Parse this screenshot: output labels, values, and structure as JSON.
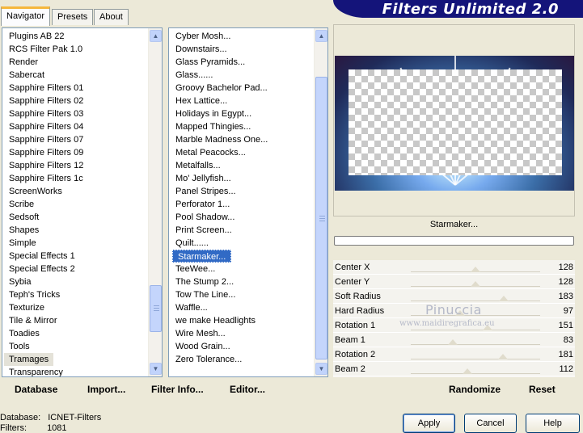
{
  "tabs": [
    "Navigator",
    "Presets",
    "About"
  ],
  "app_title": "Filters Unlimited 2.0",
  "categories": [
    "Plugins AB 22",
    "RCS Filter Pak 1.0",
    "Render",
    "Sabercat",
    "Sapphire Filters 01",
    "Sapphire Filters 02",
    "Sapphire Filters 03",
    "Sapphire Filters 04",
    "Sapphire Filters 07",
    "Sapphire Filters 09",
    "Sapphire Filters 12",
    "Sapphire Filters 1c",
    "ScreenWorks",
    "Scribe",
    "Sedsoft",
    "Shapes",
    "Simple",
    "Special Effects 1",
    "Special Effects 2",
    "Sybia",
    "Teph's Tricks",
    "Texturize",
    "Tile & Mirror",
    "Toadies",
    "Tools",
    "Tramages",
    "Transparency"
  ],
  "category_selected": "Tramages",
  "filters": [
    "Cyber Mosh...",
    "Downstairs...",
    "Glass Pyramids...",
    "Glass......",
    "Groovy Bachelor Pad...",
    "Hex Lattice...",
    "Holidays in Egypt...",
    "Mapped Thingies...",
    "Marble Madness One...",
    "Metal Peacocks...",
    "Metalfalls...",
    "Mo' Jellyfish...",
    "Panel Stripes...",
    "Perforator 1...",
    "Pool Shadow...",
    "Print Screen...",
    "Quilt......",
    "Starmaker...",
    "TeeWee...",
    "The Stump 2...",
    "Tow The Line...",
    "Waffle...",
    "we make Headlights",
    "Wire Mesh...",
    "Wood Grain...",
    "Zero Tolerance..."
  ],
  "filter_selected": "Starmaker...",
  "filter_name": "Starmaker...",
  "params": [
    {
      "label": "Center X",
      "value": "128",
      "level": 128
    },
    {
      "label": "Center Y",
      "value": "128",
      "level": 128
    },
    {
      "label": "Soft Radius",
      "value": "183",
      "level": 183
    },
    {
      "label": "Hard Radius",
      "value": "97",
      "level": 97
    },
    {
      "label": "Rotation 1",
      "value": "151",
      "level": 151
    },
    {
      "label": "Beam 1",
      "value": "83",
      "level": 83
    },
    {
      "label": "Rotation 2",
      "value": "181",
      "level": 181
    },
    {
      "label": "Beam 2",
      "value": "112",
      "level": 112
    }
  ],
  "watermark": {
    "name": "Pinuccia",
    "url": "www.maidiregrafica.eu"
  },
  "bottom_actions": {
    "database": "Database",
    "import": "Import...",
    "filter_info": "Filter Info...",
    "editor": "Editor...",
    "randomize": "Randomize",
    "reset": "Reset"
  },
  "status": {
    "db_label": "Database:",
    "db_value": "ICNET-Filters",
    "filters_label": "Filters:",
    "filters_value": "1081"
  },
  "buttons": {
    "apply": "Apply",
    "cancel": "Cancel",
    "help": "Help"
  },
  "colors": {
    "banner": "#14147a",
    "selection": "#316ac5",
    "tab_accent": "#f5b73d"
  }
}
